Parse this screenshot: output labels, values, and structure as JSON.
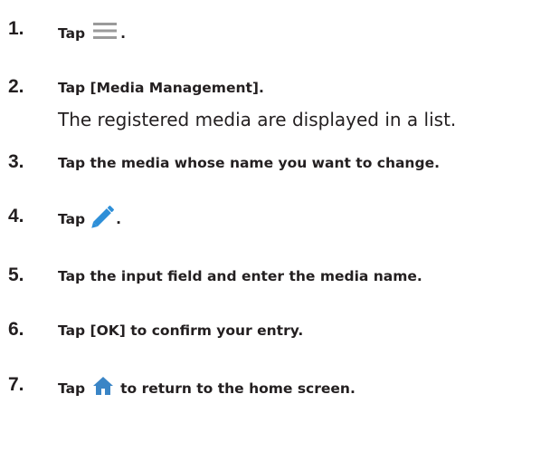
{
  "steps": [
    {
      "number": "1.",
      "before": "Tap",
      "icon": "menu-icon",
      "after": "."
    },
    {
      "number": "2.",
      "text": "Tap [Media Management].",
      "note": "The registered media are displayed in a list."
    },
    {
      "number": "3.",
      "text": "Tap the media whose name you want to change."
    },
    {
      "number": "4.",
      "before": "Tap",
      "icon": "pencil-icon",
      "after": "."
    },
    {
      "number": "5.",
      "text": "Tap the input field and enter the media name."
    },
    {
      "number": "6.",
      "text": "Tap [OK] to confirm your entry."
    },
    {
      "number": "7.",
      "before": "Tap",
      "icon": "home-icon",
      "after": "to return to the home screen."
    }
  ],
  "colors": {
    "text": "#231f20",
    "menu_icon": "#9a9a9a",
    "pencil_icon": "#2e8fd8",
    "home_icon": "#3a85c6"
  }
}
